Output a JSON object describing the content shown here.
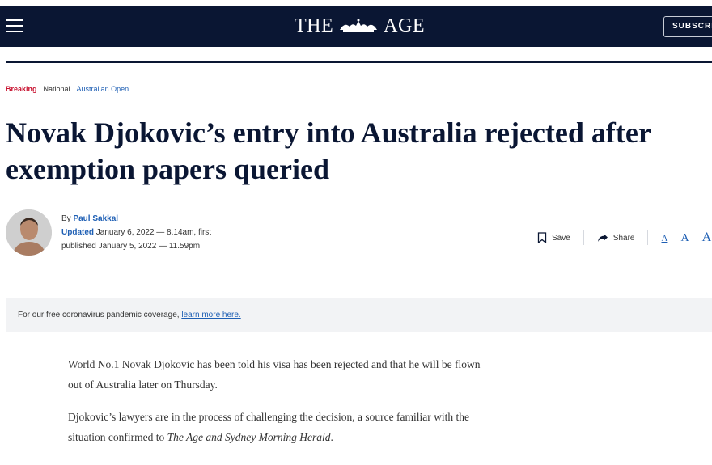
{
  "header": {
    "menu_icon": "hamburger-menu-icon",
    "logo_text_left": "THE",
    "logo_text_right": "AGE",
    "subscribe_label": "SUBSCRIBE"
  },
  "tags": {
    "breaking": "Breaking",
    "national": "National",
    "topic": "Australian Open"
  },
  "article": {
    "headline_line1": "Novak Djokovic’s entry into Australia rejected after",
    "headline_line2": "exemption papers queried",
    "byline_prefix": "By",
    "author": "Paul Sakkal",
    "updated_label": "Updated",
    "updated_text": "January 6, 2022 — 8.14am, first",
    "published_text": "published January 5, 2022 — 11.59pm"
  },
  "actions": {
    "save_label": "Save",
    "share_label": "Share",
    "font_small": "A",
    "font_medium": "A",
    "font_large": "A"
  },
  "notice": {
    "text": "For our free coronavirus pandemic coverage, ",
    "link": "learn more here."
  },
  "body": {
    "p1": "World No.1 Novak Djokovic has been told his visa has been rejected and that he will be flown out of Australia later on Thursday.",
    "p2_start": "Djokovic’s lawyers are in the process of challenging the decision, a source familiar with the situation confirmed to ",
    "p2_em": "The Age and Sydney Morning Herald",
    "p2_end": "."
  },
  "colors": {
    "navy": "#0a1633",
    "breaking_red": "#c8102e",
    "link_blue": "#1e5fb4"
  }
}
